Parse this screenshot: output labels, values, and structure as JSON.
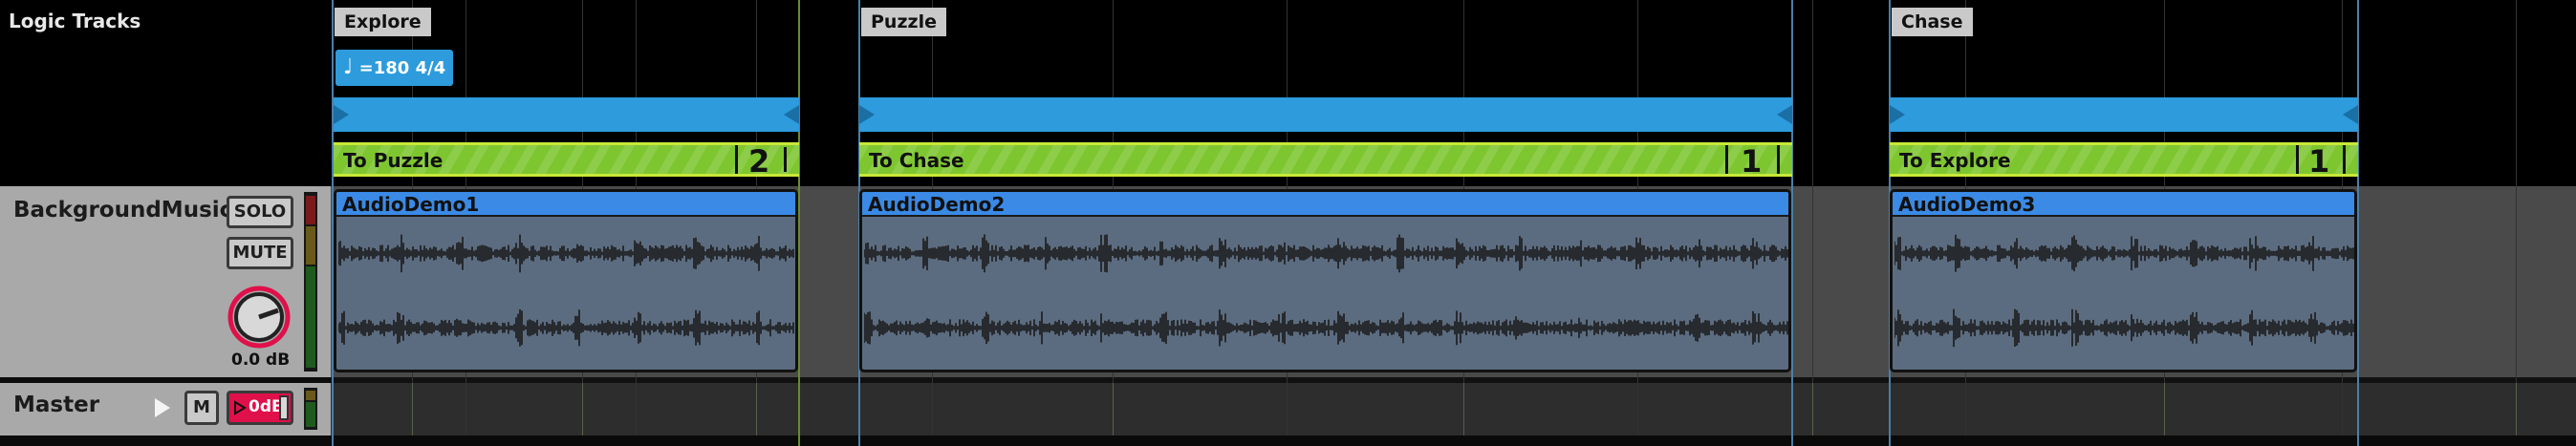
{
  "header": {
    "title": "Logic Tracks"
  },
  "track": {
    "name": "BackgroundMusic",
    "solo_label": "SOLO",
    "mute_label": "MUTE",
    "volume_readout": "0.0 dB"
  },
  "master": {
    "name": "Master",
    "mute_label": "M",
    "gain_label": "0dB"
  },
  "tempo": {
    "note_glyph": "♩",
    "text": "=180 4/4"
  },
  "markers": [
    {
      "label": "Explore"
    },
    {
      "label": "Puzzle"
    },
    {
      "label": "Chase"
    }
  ],
  "transitions": [
    {
      "label": "To Puzzle",
      "number": "2"
    },
    {
      "label": "To Chase",
      "number": "1"
    },
    {
      "label": "To Explore",
      "number": "1"
    }
  ],
  "clips": [
    {
      "name": "AudioDemo1"
    },
    {
      "name": "AudioDemo2"
    },
    {
      "name": "AudioDemo3"
    }
  ],
  "colors": {
    "region_blue": "#2d9bdc",
    "transition_green": "#7ec630",
    "clip_header_blue": "#3a8ae6",
    "master_gain_red": "#e0104a"
  }
}
